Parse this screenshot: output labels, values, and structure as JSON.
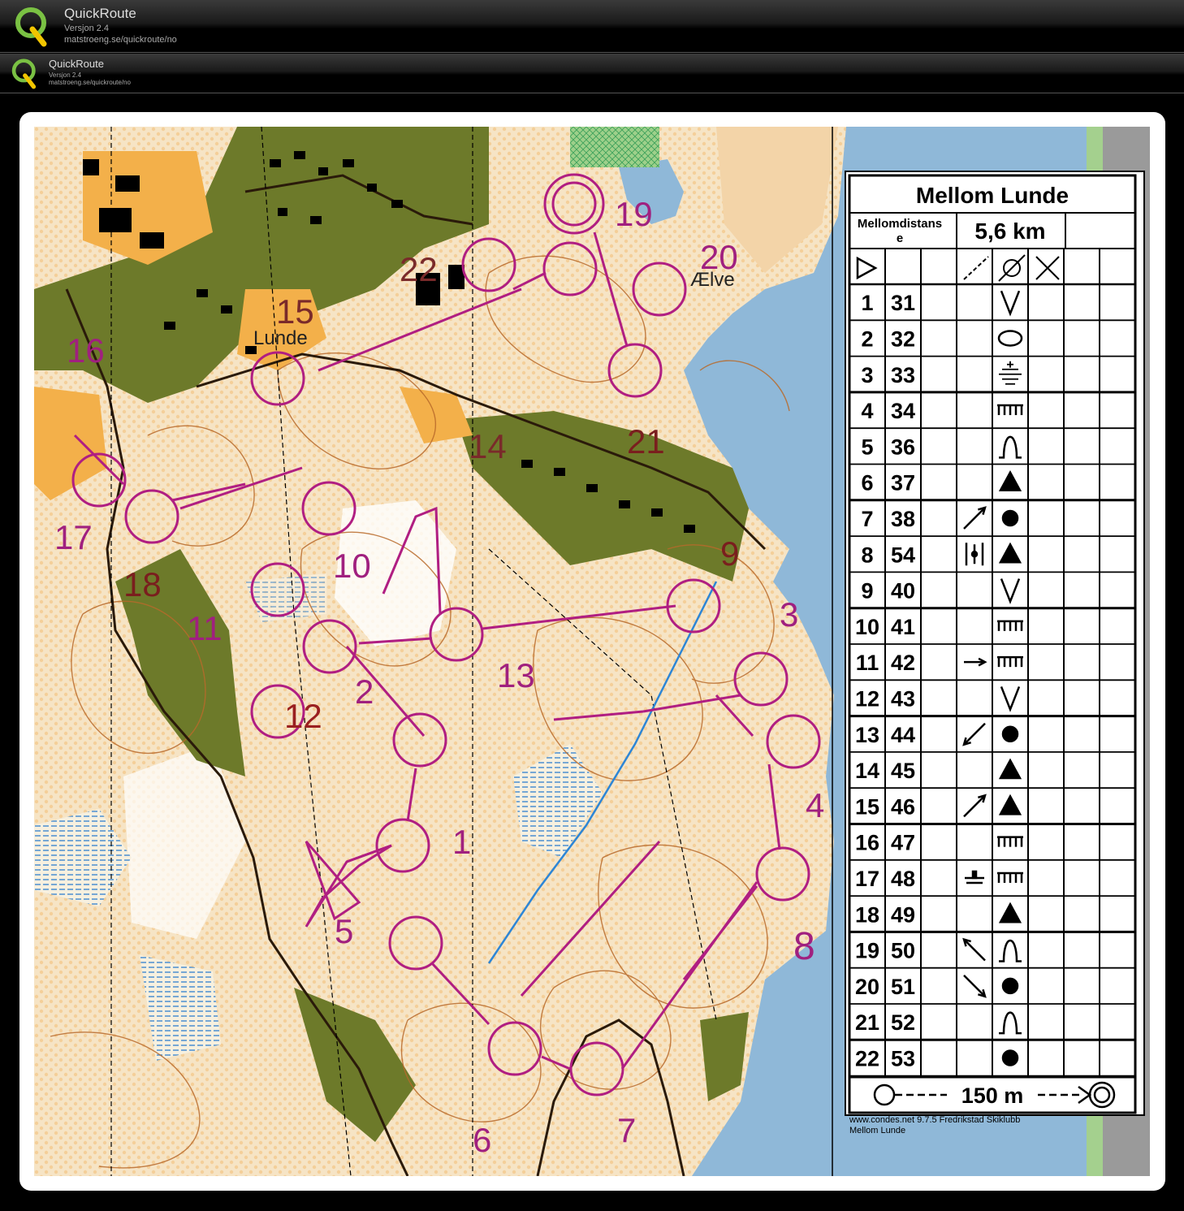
{
  "windows": [
    {
      "title": "QuickRoute",
      "version": "Versjon 2.4",
      "url": "matstroeng.se/quickroute/no"
    },
    {
      "title": "QuickRoute",
      "version": "Versjon 2.4",
      "url": "matstroeng.se/quickroute/no"
    }
  ],
  "colors": {
    "course": "#b01e82",
    "water": "#8fb8d8",
    "forest_dark": "#6d7a2a",
    "open_land": "#f3b04a",
    "terrain": "#f6e3c4",
    "contour": "#b86a2a"
  },
  "map": {
    "place_labels": [
      "Lunde",
      "Ælve"
    ],
    "control_labels": [
      "1",
      "2",
      "3",
      "4",
      "5",
      "6",
      "7",
      "8",
      "9",
      "10",
      "11",
      "12",
      "13",
      "14",
      "15",
      "16",
      "17",
      "18",
      "19",
      "20",
      "21",
      "22"
    ]
  },
  "description": {
    "title": "Mellom Lunde",
    "class": "Mellomdistanse",
    "class_line1": "Mellomdistans",
    "class_line2": "e",
    "length": "5,6 km",
    "controls": [
      {
        "n": "1",
        "code": "31",
        "dir": "",
        "feature": "V"
      },
      {
        "n": "2",
        "code": "32",
        "dir": "",
        "feature": "oval"
      },
      {
        "n": "3",
        "code": "33",
        "dir": "",
        "feature": "marsh"
      },
      {
        "n": "4",
        "code": "34",
        "dir": "",
        "feature": "cliff"
      },
      {
        "n": "5",
        "code": "36",
        "dir": "",
        "feature": "knoll"
      },
      {
        "n": "6",
        "code": "37",
        "dir": "",
        "feature": "triangle"
      },
      {
        "n": "7",
        "code": "38",
        "dir": "NE",
        "feature": "dot"
      },
      {
        "n": "8",
        "code": "54",
        "dir": "between",
        "feature": "triangle"
      },
      {
        "n": "9",
        "code": "40",
        "dir": "",
        "feature": "V"
      },
      {
        "n": "10",
        "code": "41",
        "dir": "",
        "feature": "cliff"
      },
      {
        "n": "11",
        "code": "42",
        "dir": "E",
        "feature": "cliff"
      },
      {
        "n": "12",
        "code": "43",
        "dir": "",
        "feature": "V"
      },
      {
        "n": "13",
        "code": "44",
        "dir": "SW",
        "feature": "dot"
      },
      {
        "n": "14",
        "code": "45",
        "dir": "",
        "feature": "triangle"
      },
      {
        "n": "15",
        "code": "46",
        "dir": "NE",
        "feature": "triangle"
      },
      {
        "n": "16",
        "code": "47",
        "dir": "",
        "feature": "cliff"
      },
      {
        "n": "17",
        "code": "48",
        "dir": "foot",
        "feature": "cliff"
      },
      {
        "n": "18",
        "code": "49",
        "dir": "",
        "feature": "triangle"
      },
      {
        "n": "19",
        "code": "50",
        "dir": "NW",
        "feature": "knoll"
      },
      {
        "n": "20",
        "code": "51",
        "dir": "SE",
        "feature": "dot"
      },
      {
        "n": "21",
        "code": "52",
        "dir": "",
        "feature": "knoll"
      },
      {
        "n": "22",
        "code": "53",
        "dir": "",
        "feature": "dot"
      }
    ],
    "finish_text": "150 m",
    "credit_line1": "www.condes.net 9.7.5 Fredrikstad Skiklubb",
    "credit_line2": "Mellom Lunde"
  }
}
